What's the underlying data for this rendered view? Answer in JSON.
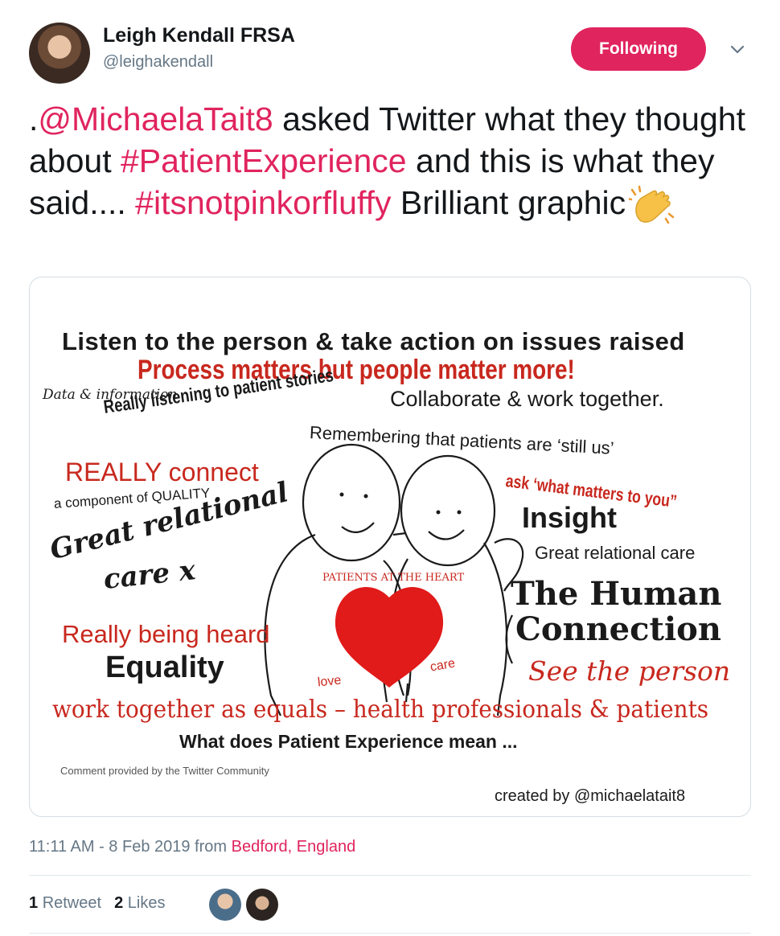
{
  "author": {
    "name": "Leigh Kendall FRSA",
    "handle": "@leighakendall",
    "follow_label": "Following"
  },
  "tweet": {
    "prefix": ".",
    "mention": "@MichaelaTait8",
    "text1": " asked Twitter what they thought about ",
    "hashtag1": "#PatientExperience",
    "text2": " and this is what they said.... ",
    "hashtag2": "#itsnotpinkorfluffy",
    "text3": " Brilliant graphic",
    "emoji": "clapping-hands"
  },
  "graphic": {
    "line1": "Listen to the person & take action on issues raised",
    "line2": "Process matters but people matter more!",
    "data_info": "Data & information",
    "stories": "Really listening to patient stories",
    "collaborate": "Collaborate & work together.",
    "remembering": "Remembering that patients are ‘still us’",
    "connect": "REALLY connect",
    "component": "a component of QUALITY",
    "what_matters": "ask ‘what matters to you”",
    "insight": "Insight",
    "relational_care": "Great relational care",
    "great_relational": "Great relational",
    "care_x": "care x",
    "heart_label": "PATIENTS AT THE HEART",
    "human_connection_1": "The Human",
    "human_connection_2": "Connection",
    "being_heard": "Really being heard",
    "equality": "Equality",
    "love": "love",
    "care": "care",
    "see_person": "See the person",
    "equals": "work together as equals – health professionals & patients",
    "meaning": "What does Patient Experience mean ...",
    "comment": "Comment provided by the Twitter Community",
    "created_by": "created by @michaelatait8"
  },
  "meta": {
    "time": "11:11 AM - 8 Feb 2019 from ",
    "location": "Bedford, England"
  },
  "stats": {
    "retweets": "1",
    "retweet_label": "Retweet",
    "likes": "2",
    "likes_label": "Likes"
  },
  "colors": {
    "accent": "#e0245e",
    "muted": "#657786",
    "graphic_red": "#c8281e"
  }
}
